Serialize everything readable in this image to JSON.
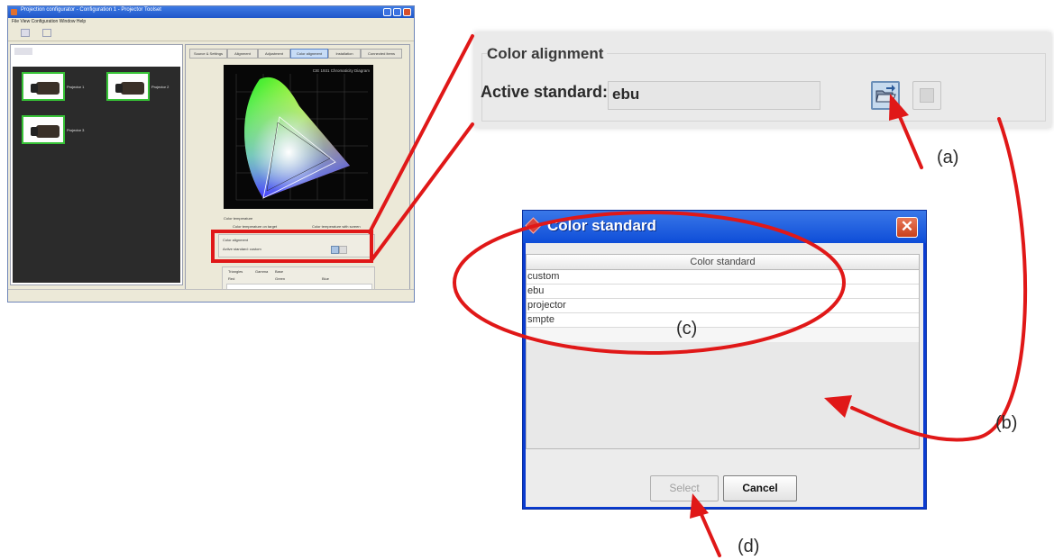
{
  "app_window": {
    "title": "Projection configurator - Configuration 1 - Projector Toolset",
    "menu": "File  View  Configuration  Window  Help",
    "tabs": [
      "Source & Settings",
      "Alignment",
      "Adjustment",
      "Color alignment",
      "Installation",
      "Connected items"
    ],
    "diagram_title": "CIE 1931 Chromaticity Diagram",
    "checks": [
      "Color temperature",
      "Color temperature on target",
      "Color temperature with screen"
    ],
    "color_alignment_mini": {
      "title": "Color alignment",
      "label": "Active standard: custom"
    },
    "table_mini": [
      "Triangles",
      "Gamma",
      "Base",
      "Red",
      "Green",
      "Blue"
    ],
    "projector_labels": [
      "Projector 1",
      "Projector 2",
      "Projector 3"
    ]
  },
  "color_alignment": {
    "legend": "Color alignment",
    "active_standard_label": "Active standard:",
    "active_standard_value": "ebu"
  },
  "dialog": {
    "title": "Color standard",
    "close_symbol": "✕",
    "column_header": "Color standard",
    "rows": [
      "custom",
      "ebu",
      "projector",
      "smpte"
    ],
    "select_label": "Select",
    "cancel_label": "Cancel"
  },
  "annotations": {
    "a": "(a)",
    "b": "(b)",
    "c": "(c)",
    "d": "(d)"
  },
  "colors": {
    "highlight": "#e01818",
    "selection_border": "#36c236",
    "dialog_title": "#0e4dd8"
  }
}
